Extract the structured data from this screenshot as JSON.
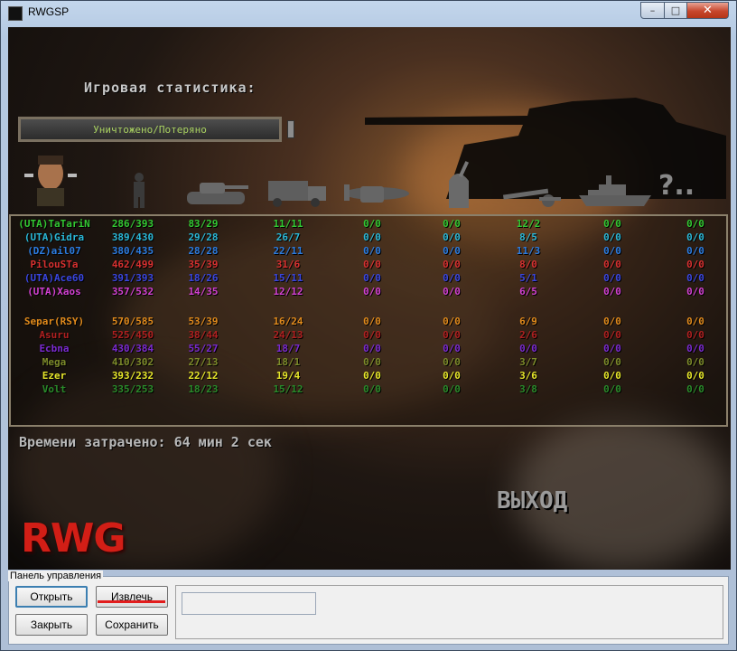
{
  "window": {
    "title": "RWGSP"
  },
  "game": {
    "heading": "Игровая статистика:",
    "category": "Уничтожено/Потеряно",
    "unknown_label": "?..",
    "time_label": "Времени затрачено: 64 мин 2 сек",
    "exit_label": "ВЫХОД",
    "logo": "RWG"
  },
  "stats": {
    "unit_icons": [
      "infantry-icon",
      "tank-icon",
      "truck-icon",
      "plane-icon",
      "bunker-icon",
      "artillery-icon",
      "ship-icon",
      "unknown-icon"
    ],
    "rows": [
      {
        "color": "#32c832",
        "values": [
          "(UTA)TaTariN",
          "286/393",
          "83/29",
          "11/11",
          "0/0",
          "0/0",
          "12/2",
          "0/0",
          "0/0"
        ]
      },
      {
        "color": "#2ab8d8",
        "values": [
          "(UTA)Gidra",
          "389/430",
          "29/28",
          "26/7",
          "0/0",
          "0/0",
          "8/5",
          "0/0",
          "0/0"
        ]
      },
      {
        "color": "#2c7ce0",
        "values": [
          "(DZ)ail07",
          "380/435",
          "28/28",
          "22/11",
          "0/0",
          "0/0",
          "11/3",
          "0/0",
          "0/0"
        ]
      },
      {
        "color": "#d83030",
        "values": [
          "PilouSTa",
          "462/499",
          "35/39",
          "31/6",
          "0/0",
          "0/0",
          "8/0",
          "0/0",
          "0/0"
        ]
      },
      {
        "color": "#3a46e0",
        "values": [
          "(UTA)Ace60",
          "391/393",
          "18/26",
          "15/11",
          "0/0",
          "0/0",
          "5/1",
          "0/0",
          "0/0"
        ]
      },
      {
        "color": "#d040d0",
        "values": [
          "(UTA)Xaos",
          "357/532",
          "14/35",
          "12/12",
          "0/0",
          "0/0",
          "6/5",
          "0/0",
          "0/0"
        ]
      },
      {
        "color": "#e08a1c",
        "values": [
          "Separ(RSY)",
          "570/585",
          "53/39",
          "16/24",
          "0/0",
          "0/0",
          "6/9",
          "0/0",
          "0/0"
        ]
      },
      {
        "color": "#b02020",
        "values": [
          "Asuru",
          "525/450",
          "38/44",
          "24/13",
          "0/0",
          "0/0",
          "2/6",
          "0/0",
          "0/0"
        ]
      },
      {
        "color": "#7a2ad0",
        "values": [
          "Ecbna",
          "430/384",
          "55/27",
          "18/7",
          "0/0",
          "0/0",
          "0/0",
          "0/0",
          "0/0"
        ]
      },
      {
        "color": "#7c8a2a",
        "values": [
          "Mega",
          "410/302",
          "27/13",
          "18/1",
          "0/0",
          "0/0",
          "3/7",
          "0/0",
          "0/0"
        ]
      },
      {
        "color": "#e6e62a",
        "values": [
          "Ezer",
          "393/232",
          "22/12",
          "19/4",
          "0/0",
          "0/0",
          "3/6",
          "0/0",
          "0/0"
        ]
      },
      {
        "color": "#2a8a2a",
        "values": [
          "Volt",
          "335/253",
          "18/23",
          "15/12",
          "0/0",
          "0/0",
          "3/8",
          "0/0",
          "0/0"
        ]
      }
    ]
  },
  "control_panel": {
    "legend": "Панель управления",
    "open": "Открыть",
    "extract": "Извлечь",
    "close": "Закрыть",
    "save": "Сохранить"
  }
}
